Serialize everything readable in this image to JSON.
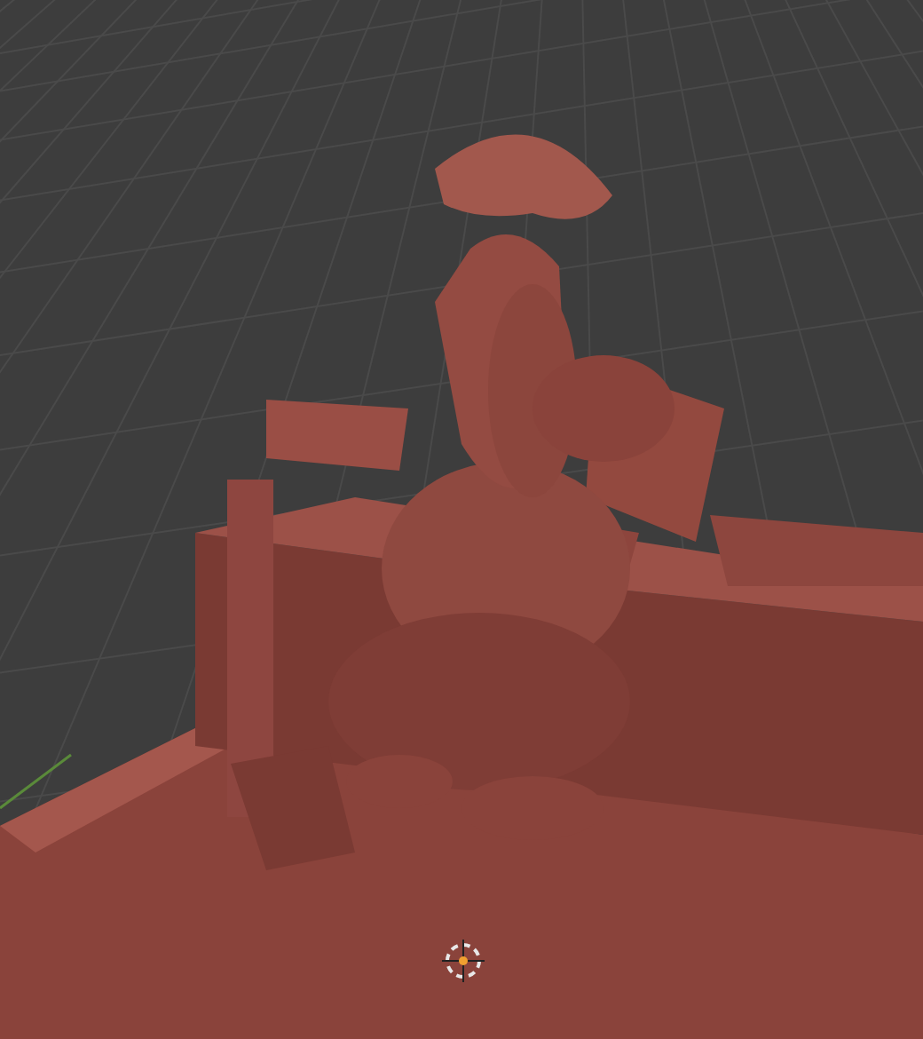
{
  "viewport": {
    "show_grid": true,
    "show_cursor": true
  }
}
